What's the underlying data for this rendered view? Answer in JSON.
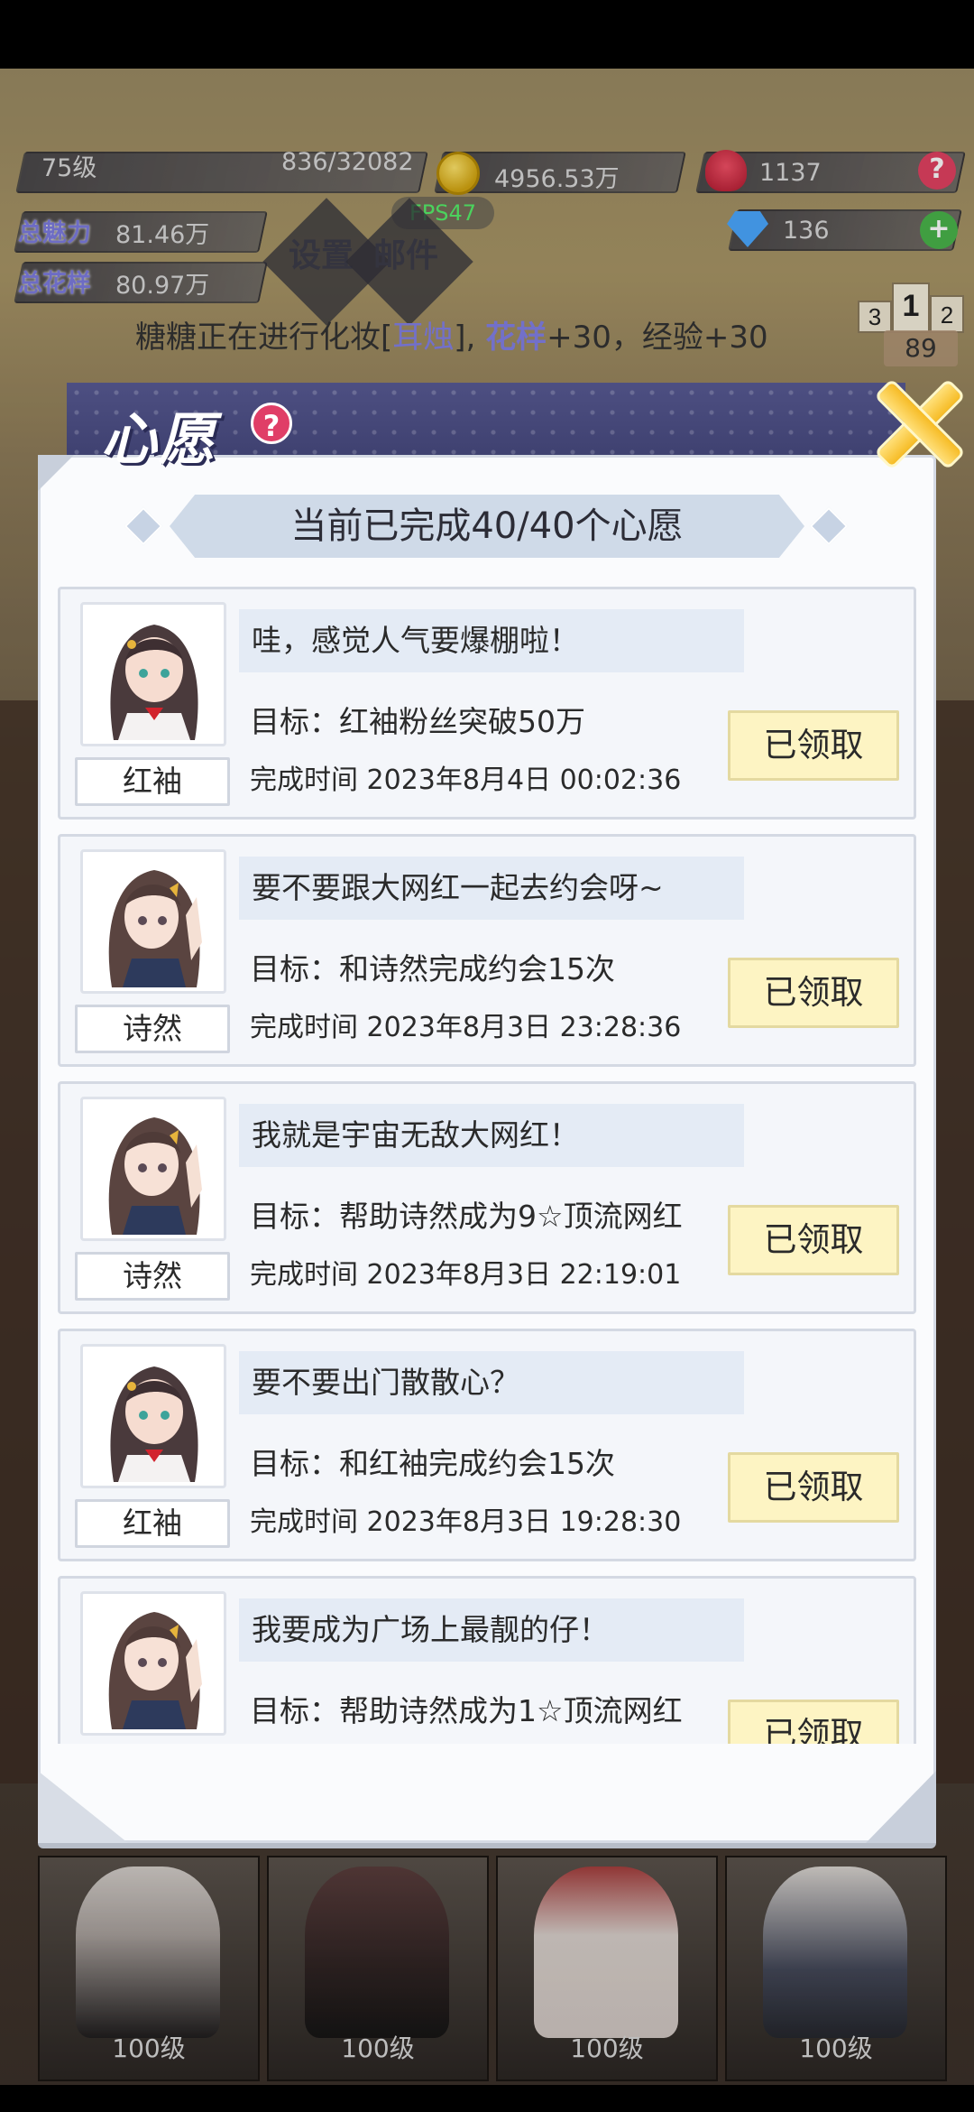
{
  "hud": {
    "level": "75级",
    "exp": "836/32082",
    "gold": "4956.53万",
    "roses": "1137",
    "diamonds": "136",
    "charm_label": "总魅力",
    "charm_value": "81.46万",
    "style_label": "总花样",
    "style_value": "80.97万",
    "fps": "FPS47",
    "menu_settings": "设置",
    "menu_mail": "邮件",
    "help_btn": "?",
    "add_btn": "+",
    "rank_value": "89",
    "rank_1": "1",
    "rank_2": "2",
    "rank_3": "3"
  },
  "banner": {
    "prefix": "糖糖正在进行化妆[",
    "item": "耳烛",
    "mid": "], ",
    "stat": "花样",
    "suffix": "+30，经验+30"
  },
  "dialog": {
    "title": "心愿",
    "help": "?",
    "progress": "当前已完成40/40个心愿",
    "wishes": [
      {
        "name": "红袖",
        "title": "哇，感觉人气要爆棚啦！",
        "goal": "目标：红袖粉丝突破50万",
        "time": "完成时间 2023年8月4日  00:02:36",
        "button": "已领取"
      },
      {
        "name": "诗然",
        "title": "要不要跟大网红一起去约会呀~",
        "goal": "目标：和诗然完成约会15次",
        "time": "完成时间 2023年8月3日  23:28:36",
        "button": "已领取"
      },
      {
        "name": "诗然",
        "title": "我就是宇宙无敌大网红！",
        "goal": "目标：帮助诗然成为9☆顶流网红",
        "time": "完成时间 2023年8月3日  22:19:01",
        "button": "已领取"
      },
      {
        "name": "红袖",
        "title": "要不要出门散散心？",
        "goal": "目标：和红袖完成约会15次",
        "time": "完成时间 2023年8月3日  19:28:30",
        "button": "已领取"
      },
      {
        "name": "",
        "title": "我要成为广场上最靓的仔！",
        "goal": "目标：帮助诗然成为1☆顶流网红",
        "time": "",
        "button": "已领取"
      }
    ]
  },
  "bottom_cards": [
    {
      "level": "100级"
    },
    {
      "level": "100级"
    },
    {
      "level": "100级"
    },
    {
      "level": "100级"
    }
  ],
  "colors": {
    "accent_purple": "#7d7be0",
    "button_yellow": "#fdf4c3",
    "header_navy": "#3a3c6a",
    "help_red": "#e03e67"
  },
  "icons": [
    "coin-icon",
    "rose-icon",
    "diamond-icon",
    "help-icon",
    "add-icon",
    "close-icon",
    "trophy-icon"
  ]
}
